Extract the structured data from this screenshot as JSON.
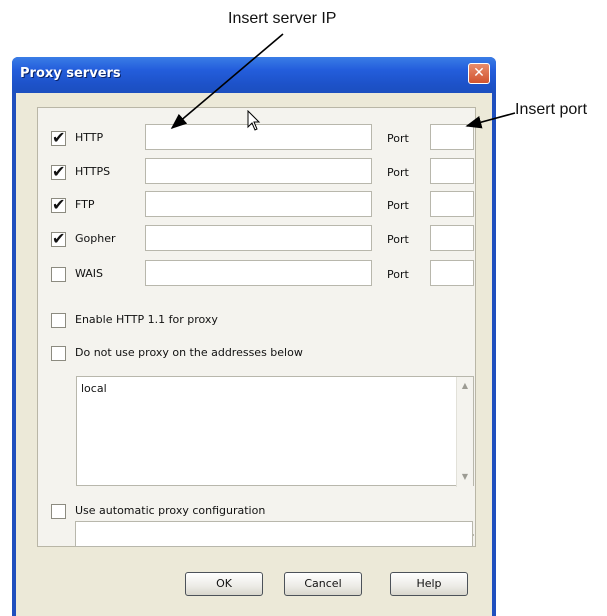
{
  "annotations": {
    "server_ip": "Insert server IP",
    "port": "Insert port"
  },
  "dialog": {
    "title": "Proxy servers",
    "close_icon": "close-icon",
    "port_label": "Port",
    "protocols": [
      {
        "label": "HTTP",
        "checked": true,
        "server": "",
        "port": ""
      },
      {
        "label": "HTTPS",
        "checked": true,
        "server": "",
        "port": ""
      },
      {
        "label": "FTP",
        "checked": true,
        "server": "",
        "port": ""
      },
      {
        "label": "Gopher",
        "checked": true,
        "server": "",
        "port": ""
      },
      {
        "label": "WAIS",
        "checked": false,
        "server": "",
        "port": ""
      }
    ],
    "options": {
      "enable_http11": {
        "label": "Enable HTTP 1.1 for proxy",
        "checked": false
      },
      "bypass_addresses": {
        "label": "Do not use proxy on the addresses below",
        "checked": false
      },
      "auto_config": {
        "label": "Use automatic proxy configuration",
        "checked": false
      }
    },
    "bypass_list": "local",
    "auto_config_url": "",
    "buttons": {
      "ok": "OK",
      "cancel": "Cancel",
      "help": "Help"
    }
  },
  "colors": {
    "titlebar": "#245edc",
    "window_body": "#ece9d8",
    "close_button": "#d1532f"
  }
}
